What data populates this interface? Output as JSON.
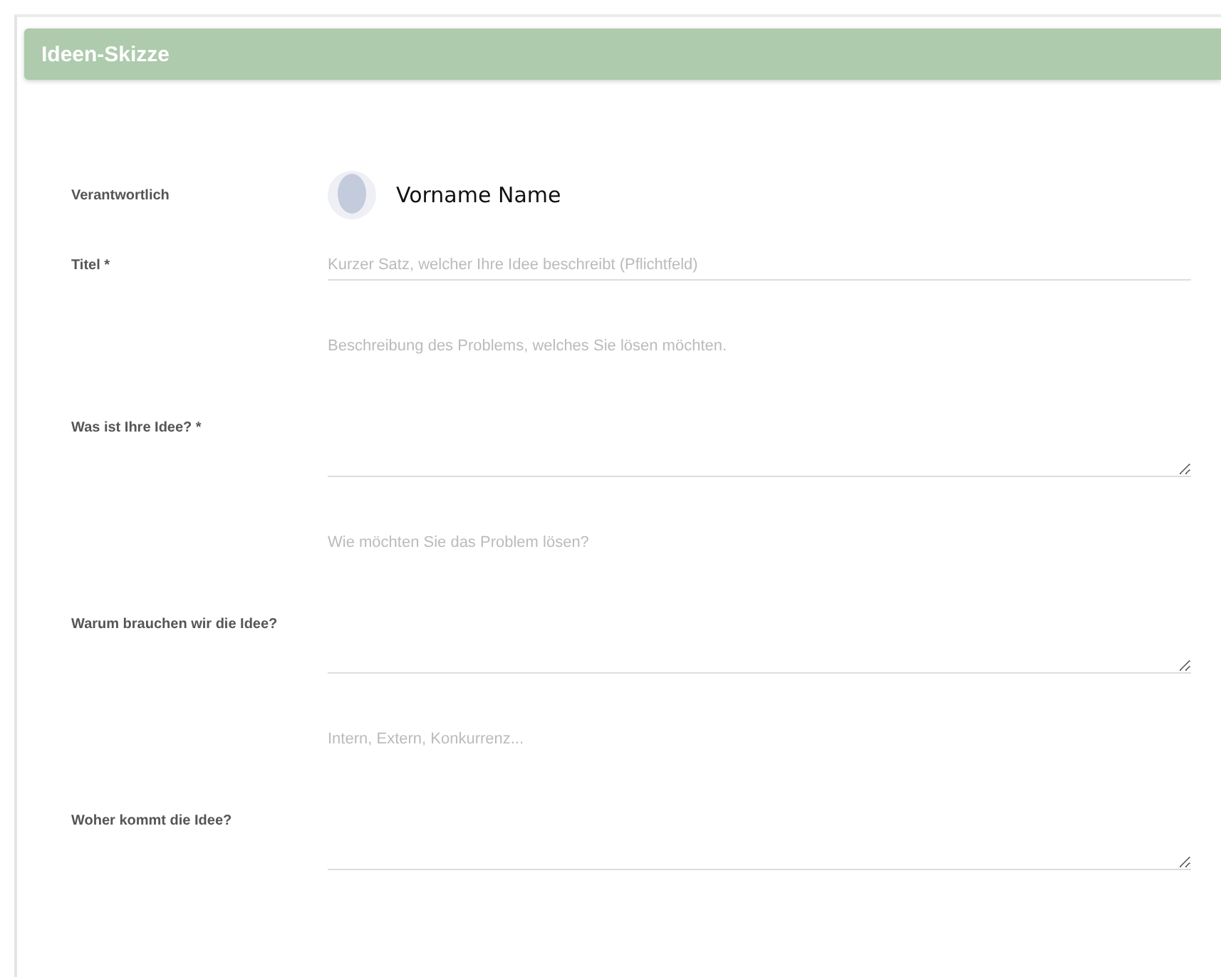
{
  "panel": {
    "title": "Ideen-Skizze"
  },
  "owner": {
    "label": "Verantwortlich",
    "name": "Vorname Name"
  },
  "fields": [
    {
      "kind": "input",
      "label": "Titel *",
      "placeholder": "Kurzer Satz, welcher Ihre Idee beschreibt (Pflichtfeld)"
    },
    {
      "kind": "textarea",
      "label": "Was ist Ihre Idee? *",
      "placeholder": "Beschreibung des Problems, welches Sie lösen möchten."
    },
    {
      "kind": "textarea",
      "label": "Warum brauchen wir die Idee?",
      "placeholder": "Wie möchten Sie das Problem lösen?"
    },
    {
      "kind": "textarea",
      "label": "Woher kommt die Idee?",
      "placeholder": "Intern, Extern, Konkurrenz..."
    }
  ]
}
